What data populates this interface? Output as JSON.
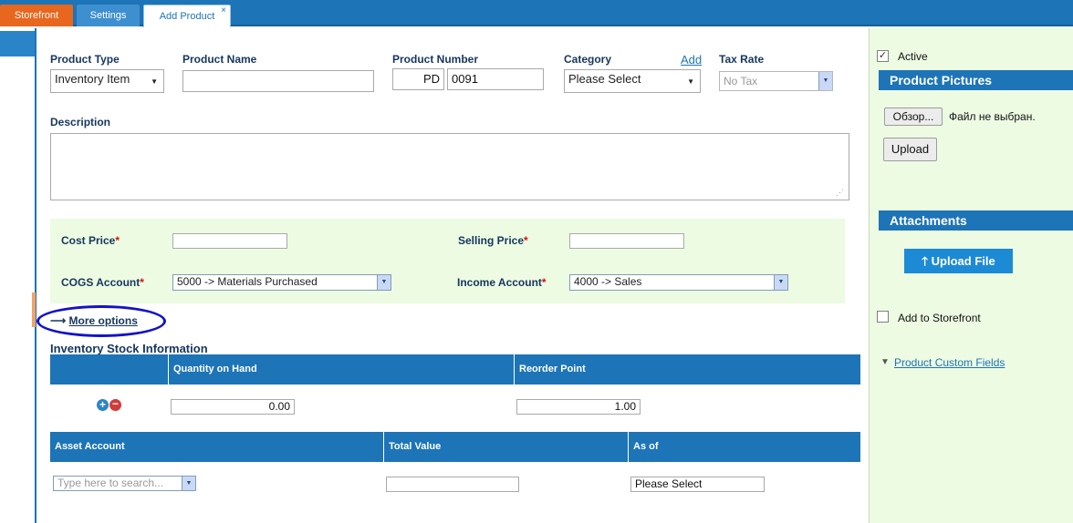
{
  "tabs": [
    {
      "label": "Storefront"
    },
    {
      "label": "Settings"
    },
    {
      "label": "Add Product",
      "close": "×"
    }
  ],
  "form": {
    "product_type": {
      "label": "Product Type",
      "value": "Inventory Item"
    },
    "product_name": {
      "label": "Product Name",
      "value": ""
    },
    "product_number": {
      "label": "Product Number",
      "prefix": "PD",
      "value": "0091"
    },
    "category": {
      "label": "Category",
      "add_link": "Add",
      "value": "Please Select"
    },
    "tax_rate": {
      "label": "Tax Rate",
      "value": "No Tax"
    },
    "description": {
      "label": "Description",
      "value": ""
    }
  },
  "pricing": {
    "cost_price": {
      "label": "Cost Price",
      "required": "*",
      "value": ""
    },
    "selling_price": {
      "label": "Selling Price",
      "required": "*",
      "value": ""
    },
    "cogs_account": {
      "label": "COGS Account",
      "required": "*",
      "value": "5000 -> Materials Purchased"
    },
    "income_account": {
      "label": "Income Account",
      "required": "*",
      "value": "4000 -> Sales"
    }
  },
  "more_options": {
    "arrow": "⟶",
    "label": "More options"
  },
  "inventory": {
    "title": "Inventory Stock Information",
    "columns": [
      "",
      "Quantity on Hand",
      "Reorder Point"
    ],
    "qty_on_hand": "0.00",
    "reorder_point": "1.00"
  },
  "asset": {
    "columns": [
      "Asset Account",
      "Total Value",
      "As of"
    ],
    "account_placeholder": "Type here to search...",
    "total_value": "",
    "as_of": "Please Select"
  },
  "sidebar": {
    "active_label": "Active",
    "active_checked": "✓",
    "pictures_title": "Product Pictures",
    "browse_label": "Обзор...",
    "no_file": "Файл не выбран.",
    "upload_label": "Upload",
    "attachments_title": "Attachments",
    "upload_file_label": "Upload File",
    "add_storefront_label": "Add to Storefront",
    "custom_fields_label": "Product Custom Fields"
  },
  "colors": {
    "brand": "#1d74b7",
    "accent_orange": "#e8671e",
    "panel_green": "#ecfbe2",
    "highlight": "#1212c8",
    "required": "#d01010"
  }
}
